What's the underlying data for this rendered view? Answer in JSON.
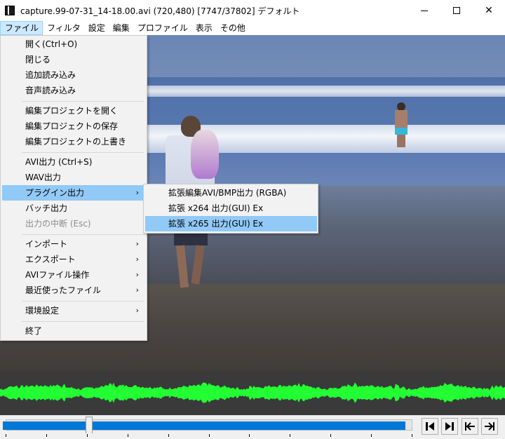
{
  "window": {
    "title": "capture.99-07-31_14-18.00.avi (720,480)  [7747/37802]  デフォルト",
    "minimize_glyph": "─",
    "maximize_glyph": "☐",
    "close_glyph": "✕"
  },
  "menubar": {
    "items": [
      "ファイル",
      "フィルタ",
      "設定",
      "編集",
      "プロファイル",
      "表示",
      "その他"
    ]
  },
  "file_menu": {
    "items": [
      {
        "label": "開く(Ctrl+O)"
      },
      {
        "label": "閉じる"
      },
      {
        "label": "追加読み込み"
      },
      {
        "label": "音声読み込み"
      },
      {
        "label": "編集プロジェクトを開く"
      },
      {
        "label": "編集プロジェクトの保存"
      },
      {
        "label": "編集プロジェクトの上書き"
      },
      {
        "label": "AVI出力 (Ctrl+S)"
      },
      {
        "label": "WAV出力"
      },
      {
        "label": "プラグイン出力",
        "arrow": "›"
      },
      {
        "label": "バッチ出力"
      },
      {
        "label": "出力の中断 (Esc)"
      },
      {
        "label": "インポート",
        "arrow": "›"
      },
      {
        "label": "エクスポート",
        "arrow": "›"
      },
      {
        "label": "AVIファイル操作",
        "arrow": "›"
      },
      {
        "label": "最近使ったファイル",
        "arrow": "›"
      },
      {
        "label": "環境設定",
        "arrow": "›"
      },
      {
        "label": "終了"
      }
    ]
  },
  "plugin_submenu": {
    "items": [
      {
        "label": "拡張編集AVI/BMP出力 (RGBA)"
      },
      {
        "label": "拡張 x264 出力(GUI) Ex"
      },
      {
        "label": "拡張 x265 出力(GUI) Ex"
      }
    ]
  },
  "seek": {
    "current_frame": 7747,
    "total_frames": 37802
  },
  "colors": {
    "waveform": "#22ff33",
    "progress": "#0078d7",
    "menu_highlight": "#91c9f7"
  },
  "icons": {
    "prev_frame": "step-back-icon",
    "next_frame": "step-forward-icon",
    "go_start": "skip-to-start-icon",
    "go_end": "skip-to-end-icon"
  }
}
